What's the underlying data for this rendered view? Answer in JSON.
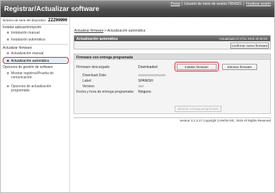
{
  "header": {
    "title": "Registrar/Actualizar software",
    "portal_link": "Portal",
    "user_text": "Usuario de inicio de sesión:7654321",
    "logout_link": "Finalizar sesión"
  },
  "sidebar": {
    "device_label": "Número de serie del dispositivo",
    "device_serial": "ZZZ99999",
    "install_category": "Instalar aplicación/opción",
    "manual_install": "Instalación manual",
    "auto_install": "Instalación automática",
    "update_category": "Actualizar firmware",
    "manual_update": "Actualización manual",
    "auto_update": "Actualización automática",
    "management_category": "Opciones de gestión de software",
    "show_logs": [
      "Mostrar registros/Prueba de",
      "comunicación"
    ],
    "update_options": [
      "Opciones de actualización",
      "programada"
    ]
  },
  "main": {
    "breadcrumb_link": "Actualizar firmware",
    "breadcrumb_sep": " > ",
    "breadcrumb_current": "Actualización automática",
    "panel1": {
      "title": "Actualización automática",
      "updated": "Actualizado el 17/11 2015 20:30:02",
      "confirm_button": "Confirmar nuevo firmware"
    },
    "panel2": {
      "title": "Firmware con entrega programada",
      "downloaded_label": "Firmware descargado",
      "downloaded_value": "Downloaded",
      "install_button": "Instalar firmware",
      "delete_button": "Eliminar firmware",
      "date_label": "Download Date:",
      "label_label": "Label:",
      "label_value": "SPANISH",
      "version_label": "Version:",
      "schedule_label": "Fecha y hora de entrega programada:",
      "schedule_value": "Ninguno",
      "cancel_button": "Eliminar entrega programada"
    },
    "copyright": "Version 3.1.3.17 Copyright CANON INC. 2015 All Rights Reserved"
  },
  "colors": {
    "header": "#4c4c4c",
    "highlight": "#e0202a",
    "panel_title": "#6a6a6a"
  }
}
